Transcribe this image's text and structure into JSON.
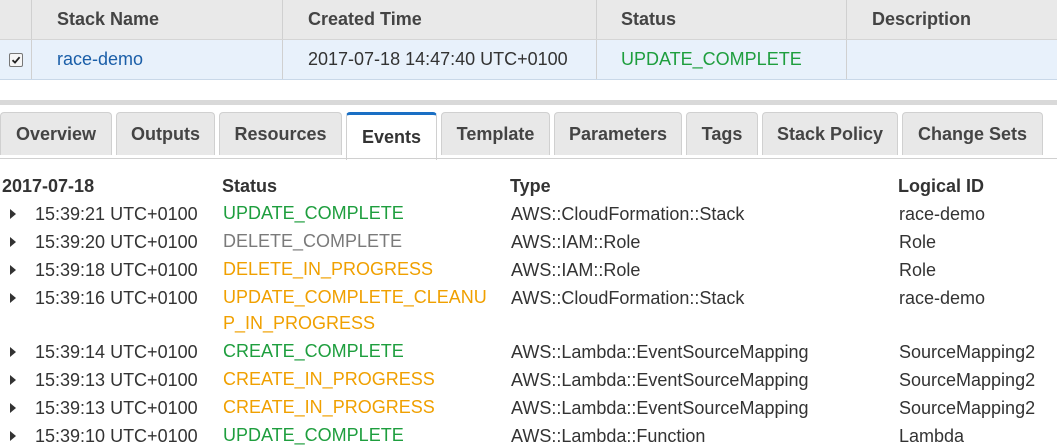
{
  "stack_table": {
    "headers": {
      "name": "Stack Name",
      "created": "Created Time",
      "status": "Status",
      "description": "Description"
    },
    "row": {
      "selected": true,
      "name": "race-demo",
      "created": "2017-07-18 14:47:40 UTC+0100",
      "status": "UPDATE_COMPLETE",
      "description": ""
    }
  },
  "tabs": [
    {
      "label": "Overview"
    },
    {
      "label": "Outputs"
    },
    {
      "label": "Resources"
    },
    {
      "label": "Events",
      "active": true
    },
    {
      "label": "Template"
    },
    {
      "label": "Parameters"
    },
    {
      "label": "Tags"
    },
    {
      "label": "Stack Policy"
    },
    {
      "label": "Change Sets"
    }
  ],
  "events": {
    "headers": {
      "date": "2017-07-18",
      "status": "Status",
      "type": "Type",
      "logical_id": "Logical ID"
    },
    "rows": [
      {
        "time": "15:39:21 UTC+0100",
        "status": "UPDATE_COMPLETE",
        "type": "AWS::CloudFormation::Stack",
        "logical_id": "race-demo"
      },
      {
        "time": "15:39:20 UTC+0100",
        "status": "DELETE_COMPLETE",
        "type": "AWS::IAM::Role",
        "logical_id": "Role"
      },
      {
        "time": "15:39:18 UTC+0100",
        "status": "DELETE_IN_PROGRESS",
        "type": "AWS::IAM::Role",
        "logical_id": "Role"
      },
      {
        "time": "15:39:16 UTC+0100",
        "status": "UPDATE_COMPLETE_CLEANUP_IN_PROGRESS",
        "type": "AWS::CloudFormation::Stack",
        "logical_id": "race-demo"
      },
      {
        "time": "15:39:14 UTC+0100",
        "status": "CREATE_COMPLETE",
        "type": "AWS::Lambda::EventSourceMapping",
        "logical_id": "SourceMapping2"
      },
      {
        "time": "15:39:13 UTC+0100",
        "status": "CREATE_IN_PROGRESS",
        "type": "AWS::Lambda::EventSourceMapping",
        "logical_id": "SourceMapping2"
      },
      {
        "time": "15:39:13 UTC+0100",
        "status": "CREATE_IN_PROGRESS",
        "type": "AWS::Lambda::EventSourceMapping",
        "logical_id": "SourceMapping2"
      },
      {
        "time": "15:39:10 UTC+0100",
        "status": "UPDATE_COMPLETE",
        "type": "AWS::Lambda::Function",
        "logical_id": "Lambda"
      }
    ]
  },
  "colors": {
    "complete": "#1e9e3e",
    "in_progress": "#f0a000",
    "deleted": "#7a7a7a",
    "link": "#1a5ea8",
    "active_tab": "#1a6fc4"
  },
  "icons": {
    "checkbox": "checkbox-checked",
    "row_expand": "caret-right"
  }
}
